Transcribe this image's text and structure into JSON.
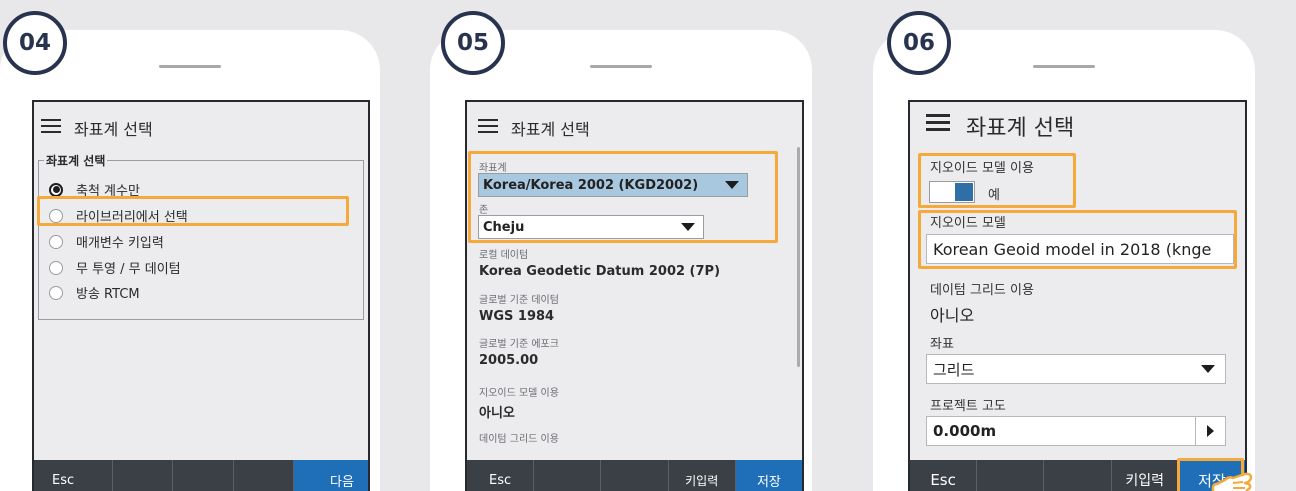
{
  "panels": [
    {
      "step": "04",
      "title": "좌표계 선택",
      "group_label": "좌표계 선택",
      "options": [
        "축척 계수만",
        "라이브러리에서 선택",
        "매개변수 키입력",
        "무 투영 / 무 데이텀",
        "방송 RTCM"
      ],
      "selected_index": 0,
      "buttons": [
        "Esc",
        "",
        "",
        "",
        "다음"
      ]
    },
    {
      "step": "05",
      "title": "좌표계 선택",
      "coord_system_label": "좌표계",
      "coord_system_value": "Korea/Korea 2002 (KGD2002)",
      "zone_label": "존",
      "zone_value": "Cheju",
      "local_datum_label": "로컬 데이텀",
      "local_datum_value": "Korea Geodetic Datum 2002 (7P)",
      "global_datum_label": "글로벌 기준 데이텀",
      "global_datum_value": "WGS 1984",
      "global_epoch_label": "글로벌 기준 에포크",
      "global_epoch_value": "2005.00",
      "geoid_use_label": "지오이드 모델 이용",
      "geoid_use_value": "아니오",
      "datum_grid_label": "데이텀 그리드 이용",
      "buttons": [
        "Esc",
        "",
        "",
        "키입력",
        "저장"
      ]
    },
    {
      "step": "06",
      "title": "좌표계 선택",
      "geoid_use_label": "지오이드 모델 이용",
      "geoid_toggle_text": "예",
      "geoid_toggle_on": true,
      "geoid_model_label": "지오이드 모델",
      "geoid_model_value": "Korean Geoid model in 2018 (knge",
      "datum_grid_label": "데이텀 그리드 이용",
      "datum_grid_value": "아니오",
      "coords_label": "좌표",
      "coords_value": "그리드",
      "project_height_label": "프로젝트 고도",
      "project_height_value": "0.000m",
      "buttons": [
        "Esc",
        "",
        "",
        "키입력",
        "저장"
      ]
    }
  ],
  "colors": {
    "highlight": "#f5a93a",
    "badge_border": "#28344f",
    "primary_button": "#1e6fb8",
    "bottom_bar": "#3b3f46"
  },
  "icons": [
    "hamburger-icon",
    "caret-down-icon",
    "arrow-right-icon",
    "pointing-hand-icon"
  ]
}
